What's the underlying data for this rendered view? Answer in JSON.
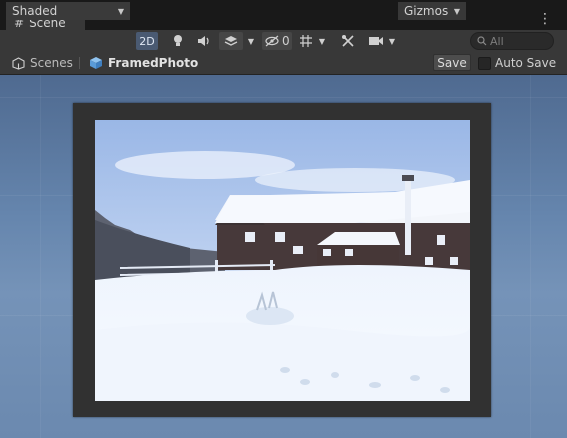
{
  "tab": {
    "icon": "hash-icon",
    "label": "Scene"
  },
  "toolbar": {
    "shading_mode": "Shaded",
    "mode_2d": "2D",
    "hidden_count": "0",
    "gizmos": "Gizmos",
    "search_placeholder": "All"
  },
  "breadcrumb": {
    "root": "Scenes",
    "current": "FramedPhoto"
  },
  "prefab_bar": {
    "save_label": "Save",
    "autosave_label": "Auto Save",
    "autosave_checked": false
  },
  "colors": {
    "accent": "#3a79bb",
    "panel": "#383838",
    "background": "#191919",
    "sky_top": "#4f6a90",
    "sky_bottom": "#7593b8",
    "frame": "#313131"
  }
}
